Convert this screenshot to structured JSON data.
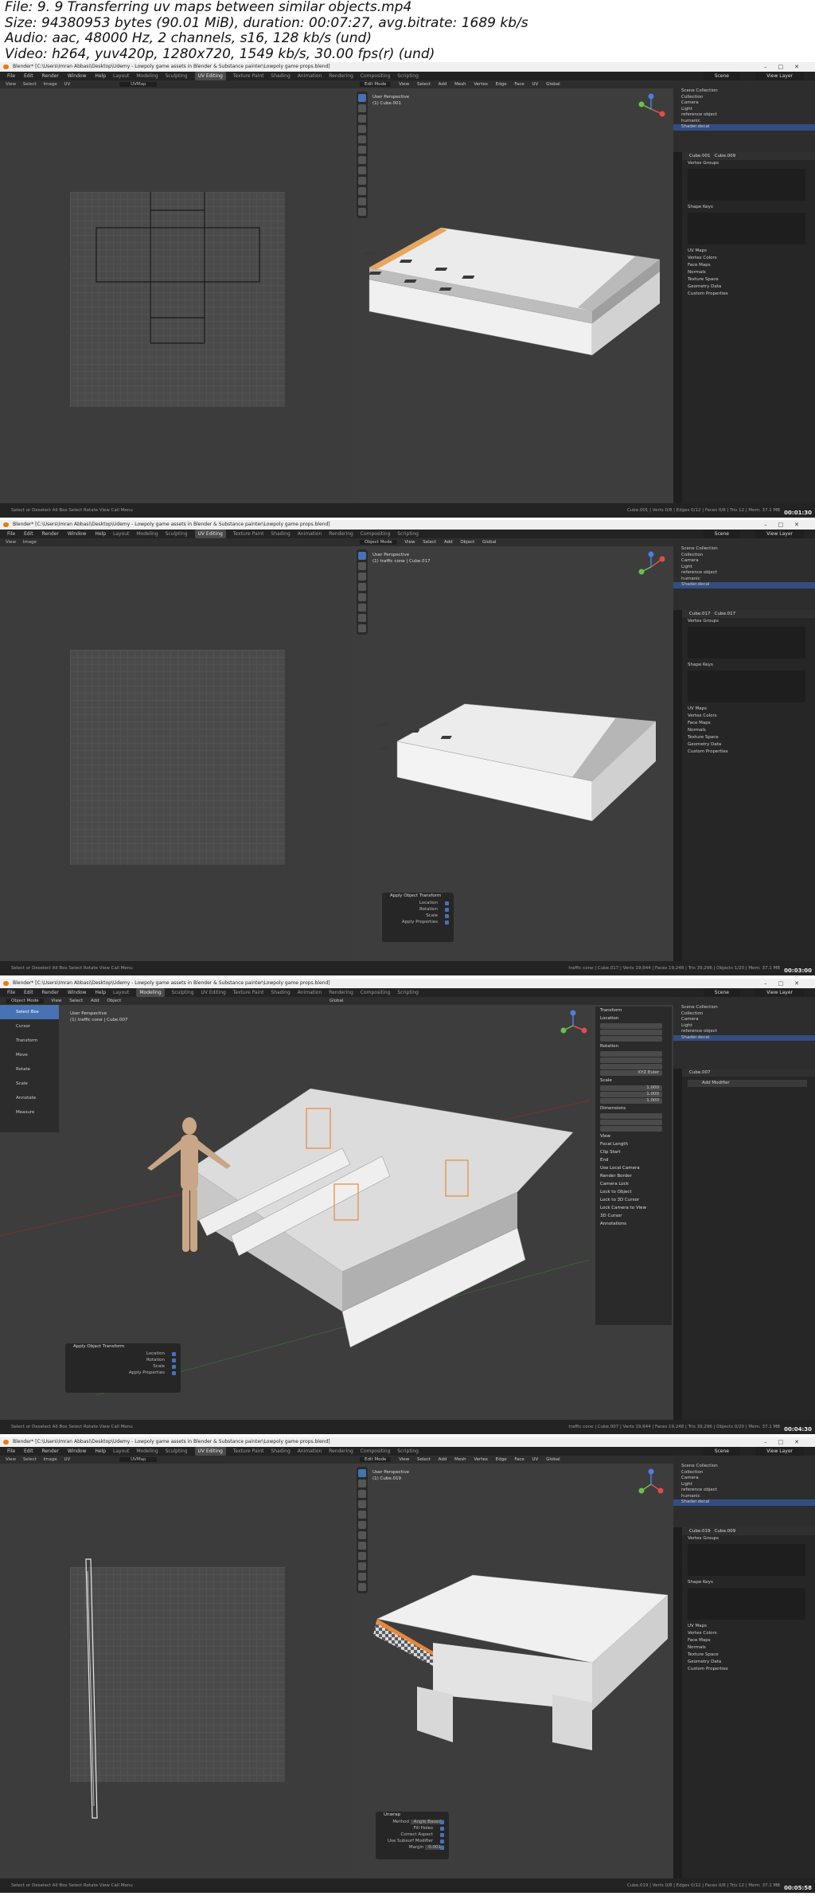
{
  "header": {
    "line1": "File: 9. 9 Transferring uv maps between similar objects.mp4",
    "line2": "Size: 94380953 bytes (90.01 MiB), duration: 00:07:27, avg.bitrate: 1689 kb/s",
    "line3": "Audio: aac, 48000 Hz, 2 channels, s16, 128 kb/s (und)",
    "line4": "Video: h264, yuv420p, 1280x720, 1549 kb/s, 30.00 fps(r) (und)"
  },
  "common": {
    "window_title": "Blender* [C:\\Users\\Imran Abbasi\\Desktop\\Udemy - Lowpoly game assets in Blender & Substance painter\\Lowpoly game props.blend]",
    "menus": [
      "File",
      "Edit",
      "Render",
      "Window",
      "Help"
    ],
    "workspaces": [
      "Layout",
      "Modeling",
      "Sculpting",
      "UV Editing",
      "Texture Paint",
      "Shading",
      "Animation",
      "Rendering",
      "Compositing",
      "Scripting"
    ],
    "scene_label": "Scene",
    "view_layer_label": "View Layer",
    "outliner_rows": [
      "Scene Collection",
      "Collection",
      "Camera",
      "Light",
      "reference object",
      "humanic",
      "Shader.decal"
    ],
    "props_sections": [
      "Vertex Groups",
      "Shape Keys",
      "UV Maps",
      "Vertex Colors",
      "Face Maps",
      "Normals",
      "Texture Space",
      "Geometry Data",
      "Custom Properties"
    ],
    "statusbar_left": "Select or Deselect All     Box Select     Rotate View     Call Menu",
    "uv_header_items": [
      "View",
      "Select",
      "Image",
      "UV",
      "UVMap"
    ],
    "vp_header_items": [
      "Edit Mode",
      "View",
      "Select",
      "Add",
      "Mesh",
      "Vertex",
      "Edge",
      "Face",
      "UV",
      "Global"
    ],
    "vp_header_object": [
      "Object Mode",
      "View",
      "Select",
      "Add",
      "Object",
      "Global"
    ]
  },
  "frames": [
    {
      "active_workspace": "UV Editing",
      "vp_title": "User Perspective",
      "vp_object": "(1) Cube.001",
      "object_name": "Cube.001",
      "mesh_name": "Cube.009",
      "stats": "Cube.001 | Verts 0/8 | Edges 0/12 | Faces 0/6 | Tris 12 | Mem: 37.1 MB",
      "timestamp": "00:01:30"
    },
    {
      "active_workspace": "UV Editing",
      "vp_title": "User Perspective",
      "vp_object": "(1) traffic cone | Cube.017",
      "object_name": "Cube.017",
      "mesh_name": "Cube.017",
      "stats": "traffic cone | Cube.017 | Verts 19,644 | Faces 19,248 | Tris 39,296 | Objects 1/20 | Mem: 37.1 MB",
      "redo_title": "Apply Object Transform",
      "redo_rows": [
        "Location",
        "Rotation",
        "Scale",
        "Apply Properties"
      ],
      "timestamp": "00:03:00"
    },
    {
      "active_workspace": "Modeling",
      "vp_title": "User Perspective",
      "vp_object": "(1) traffic cone | Cube.007",
      "object_name": "Cube.007",
      "modifier_label": "Add Modifier",
      "stats": "traffic cone | Cube.007 | Verts 19,644 | Faces 19,248 | Tris 39,296 | Objects 0/20 | Mem: 37.1 MB",
      "tools": [
        "Select Box",
        "Cursor",
        "Transform",
        "Move",
        "Rotate",
        "Scale",
        "Annotate",
        "Measure"
      ],
      "npanel_sections": [
        "Transform",
        "Location",
        "Rotation",
        "XYZ Euler",
        "Scale",
        "Dimensions",
        "View",
        "3D Cursor",
        "Annotations"
      ],
      "npanel_view_rows": [
        "Focal Length",
        "Clip Start",
        "End",
        "Use Local Camera",
        "Render Border",
        "Camera Lock",
        "Lock to Object",
        "Lock to 3D Cursor",
        "Lock Camera to View"
      ],
      "scale_values": [
        "1.000",
        "1.000",
        "1.000"
      ],
      "redo_title": "Apply Object Transform",
      "redo_rows": [
        "Location",
        "Rotation",
        "Scale",
        "Apply Properties"
      ],
      "timestamp": "00:04:30"
    },
    {
      "active_workspace": "UV Editing",
      "vp_title": "User Perspective",
      "vp_object": "(1) Cube.019",
      "object_name": "Cube.019",
      "mesh_name": "Cube.009",
      "stats": "Cube.019 | Verts 0/8 | Edges 0/12 | Faces 0/6 | Tris 12 | Mem: 37.1 MB",
      "redo_title": "Unwrap",
      "redo_rows": [
        "Method",
        "Fill Holes",
        "Correct Aspect",
        "Use Subsurf Modifier",
        "Margin"
      ],
      "unwrap_method": "Angle Based",
      "unwrap_margin": "0.001",
      "timestamp": "00:05:58"
    }
  ]
}
